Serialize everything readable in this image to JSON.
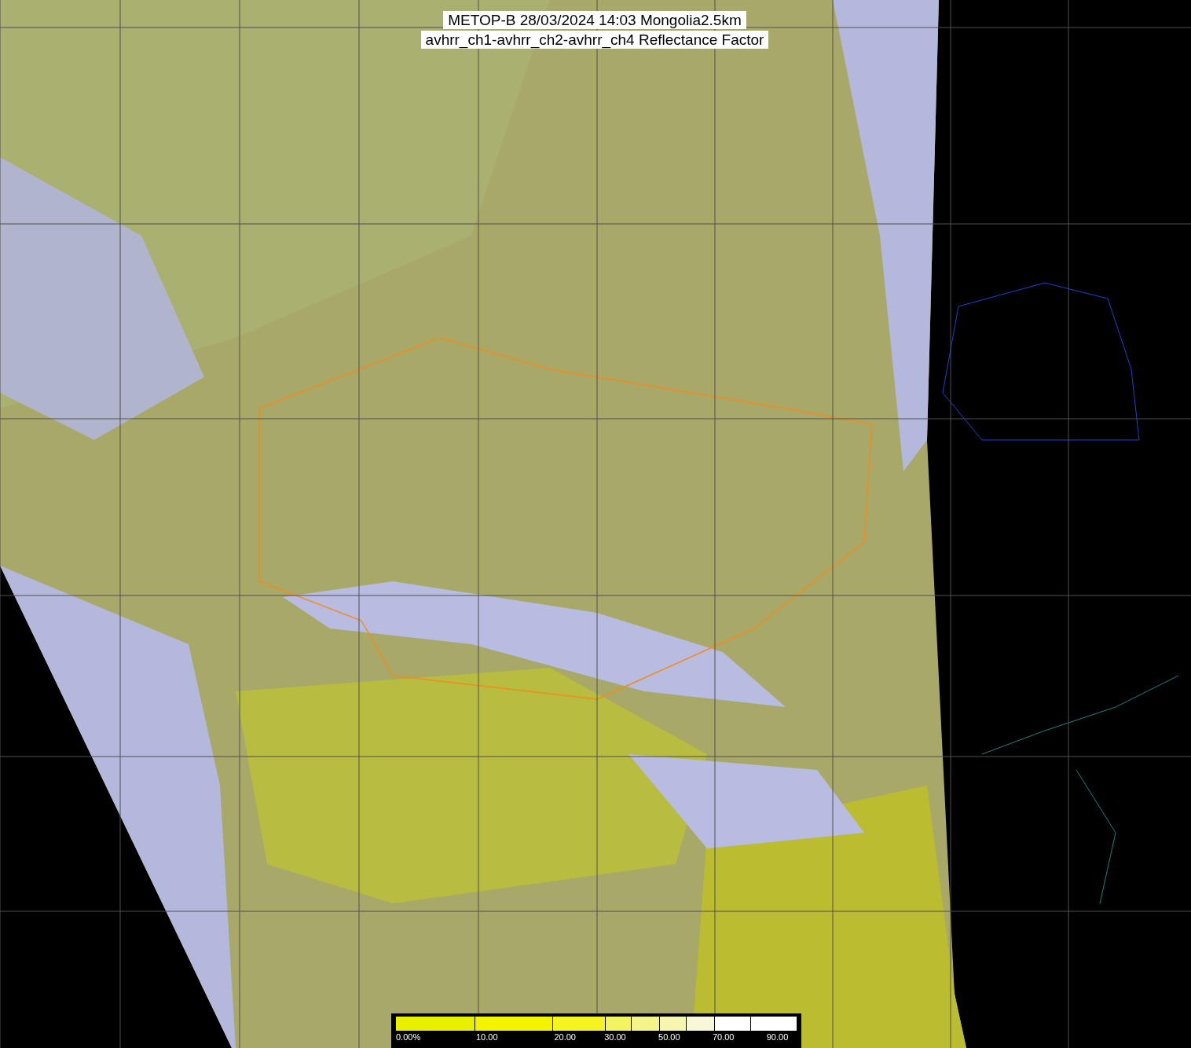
{
  "title": {
    "line_1": "METOP-B 28/03/2024 14:03 Mongolia2.5km",
    "line_2": "avhrr_ch1-avhrr_ch2-avhrr_ch4 Reflectance Factor"
  },
  "colorbar": {
    "labels": [
      "0.00%",
      "10.00",
      "20.00",
      "30.00",
      "50.00",
      "70.00",
      "90.00"
    ]
  }
}
